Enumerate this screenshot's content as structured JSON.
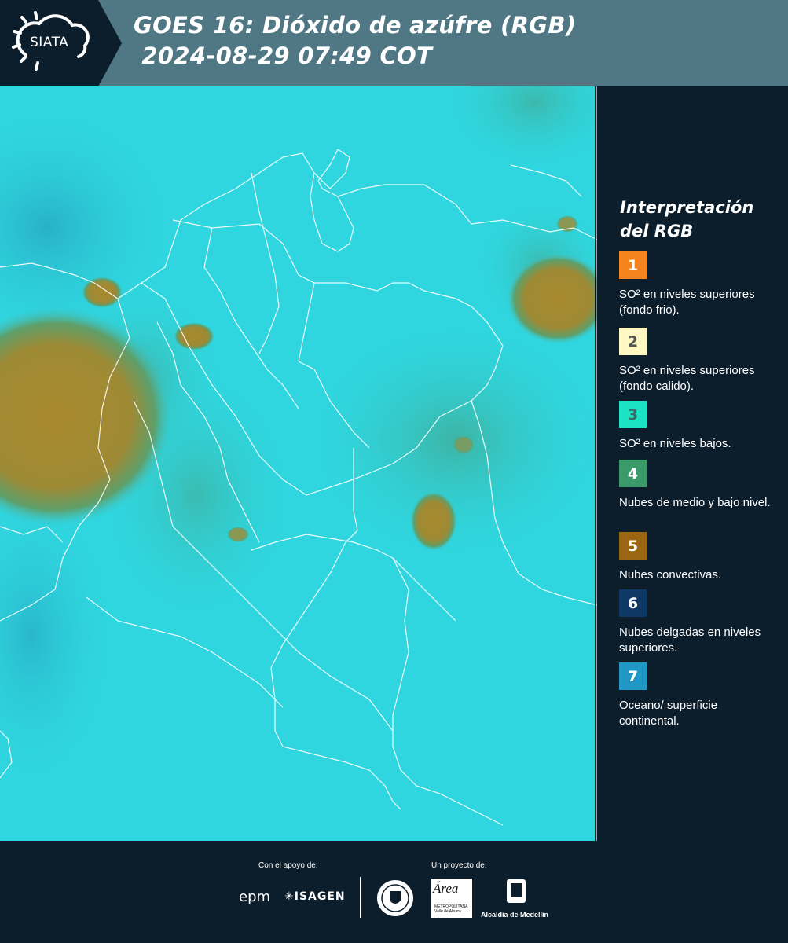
{
  "header": {
    "logo_text": "SIATA",
    "title_line1": "GOES 16: Dióxido de azúfre (RGB)",
    "title_line2": " 2024-08-29 07:49 COT",
    "background_color": "#4f7784",
    "logo_block_color": "#0c1e2c"
  },
  "map": {
    "background_color": "#2fd6df",
    "convective_cloud_color": "#a8892d",
    "mid_low_cloud_color": "#3fa58a",
    "border_color": "#ffffff"
  },
  "legend": {
    "title": "Interpretación del RGB",
    "items": [
      {
        "number": "1",
        "label": "SO² en niveles superiores (fondo frio).",
        "color": "#f5841f",
        "text_color": "#ffffff"
      },
      {
        "number": "2",
        "label": "SO² en niveles superiores (fondo calido).",
        "color": "#fff8c2",
        "text_color": "#555555"
      },
      {
        "number": "3",
        "label": "SO² en niveles bajos.",
        "color": "#1de3c5",
        "text_color": "#3a6b66"
      },
      {
        "number": "4",
        "label": "Nubes de medio y bajo nivel.",
        "color": "#3a9a6a",
        "text_color": "#ffffff"
      },
      {
        "number": "5",
        "label": "Nubes convectivas.",
        "color": "#9a6612",
        "text_color": "#ffffff"
      },
      {
        "number": "6",
        "label": "Nubes delgadas en niveles superiores.",
        "color": "#0e3966",
        "text_color": "#ffffff"
      },
      {
        "number": "7",
        "label": "Oceano/ superficie continental.",
        "color": "#1f98c6",
        "text_color": "#ffffff"
      }
    ]
  },
  "footer": {
    "support_caption": "Con el apoyo de:",
    "project_caption": "Un proyecto de:",
    "epm": "epm",
    "isagen": "ISAGEN",
    "area_metro": "Área",
    "area_metro_sub": "METROPOLITANA Valle de Aburrá",
    "alcaldia": "Alcaldía de Medellín"
  }
}
